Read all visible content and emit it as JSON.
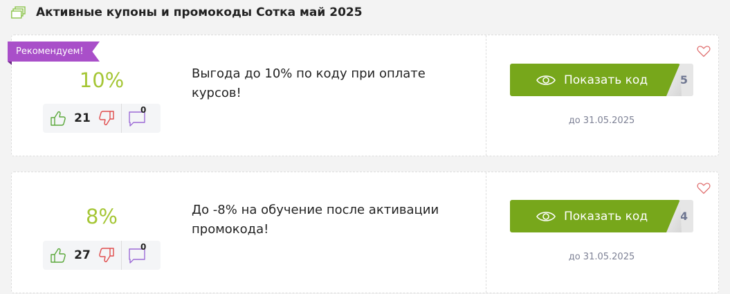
{
  "header": {
    "title": "Активные купоны и промокоды Сотка май 2025",
    "icon": "coupons-icon"
  },
  "coupons": [
    {
      "badge": "Рекомендуем!",
      "percent": "10%",
      "description": "Выгода до 10% по коду при оплате курсов!",
      "likes": "21",
      "comments": "0",
      "button_label": "Показать код",
      "uses": "5",
      "expiry": "до 31.05.2025"
    },
    {
      "percent": "8%",
      "description": "До -8% на обучение после активации промокода!",
      "likes": "27",
      "comments": "0",
      "button_label": "Показать код",
      "uses": "4",
      "expiry": "до 31.05.2025"
    }
  ],
  "colors": {
    "accent_green": "#77a71b",
    "percent_green": "#a5c635",
    "badge_purple": "#a94fc9",
    "like_green": "#5aa83a",
    "dislike_red": "#e04b4b",
    "comment_purple": "#9c6ad6",
    "heart_red": "#e07070"
  }
}
